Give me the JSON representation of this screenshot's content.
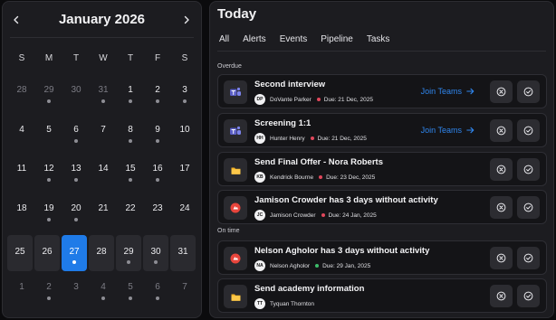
{
  "calendar": {
    "month_title": "January 2026",
    "weekdays": [
      "S",
      "M",
      "T",
      "W",
      "T",
      "F",
      "S"
    ],
    "weeks": [
      [
        {
          "d": "28",
          "m": true,
          "dot": false
        },
        {
          "d": "29",
          "m": true,
          "dot": true
        },
        {
          "d": "30",
          "m": true,
          "dot": false
        },
        {
          "d": "31",
          "m": true,
          "dot": true
        },
        {
          "d": "1",
          "m": false,
          "dot": true
        },
        {
          "d": "2",
          "m": false,
          "dot": true
        },
        {
          "d": "3",
          "m": false,
          "dot": true
        }
      ],
      [
        {
          "d": "4",
          "m": false,
          "dot": false
        },
        {
          "d": "5",
          "m": false,
          "dot": false
        },
        {
          "d": "6",
          "m": false,
          "dot": true
        },
        {
          "d": "7",
          "m": false,
          "dot": false
        },
        {
          "d": "8",
          "m": false,
          "dot": true
        },
        {
          "d": "9",
          "m": false,
          "dot": true
        },
        {
          "d": "10",
          "m": false,
          "dot": false
        }
      ],
      [
        {
          "d": "11",
          "m": false,
          "dot": false
        },
        {
          "d": "12",
          "m": false,
          "dot": true
        },
        {
          "d": "13",
          "m": false,
          "dot": true
        },
        {
          "d": "14",
          "m": false,
          "dot": false
        },
        {
          "d": "15",
          "m": false,
          "dot": true
        },
        {
          "d": "16",
          "m": false,
          "dot": true
        },
        {
          "d": "17",
          "m": false,
          "dot": false
        }
      ],
      [
        {
          "d": "18",
          "m": false,
          "dot": false
        },
        {
          "d": "19",
          "m": false,
          "dot": true
        },
        {
          "d": "20",
          "m": false,
          "dot": true
        },
        {
          "d": "21",
          "m": false,
          "dot": false
        },
        {
          "d": "22",
          "m": false,
          "dot": false
        },
        {
          "d": "23",
          "m": false,
          "dot": false
        },
        {
          "d": "24",
          "m": false,
          "dot": false
        }
      ],
      [
        {
          "d": "25",
          "m": false,
          "dot": false
        },
        {
          "d": "26",
          "m": false,
          "dot": false
        },
        {
          "d": "27",
          "m": false,
          "dot": true,
          "sel": true
        },
        {
          "d": "28",
          "m": false,
          "dot": false
        },
        {
          "d": "29",
          "m": false,
          "dot": true
        },
        {
          "d": "30",
          "m": false,
          "dot": true
        },
        {
          "d": "31",
          "m": false,
          "dot": false
        }
      ],
      [
        {
          "d": "1",
          "m": true,
          "dot": false
        },
        {
          "d": "2",
          "m": true,
          "dot": true
        },
        {
          "d": "3",
          "m": true,
          "dot": false
        },
        {
          "d": "4",
          "m": true,
          "dot": true
        },
        {
          "d": "5",
          "m": true,
          "dot": true
        },
        {
          "d": "6",
          "m": true,
          "dot": true
        },
        {
          "d": "7",
          "m": true,
          "dot": false
        }
      ]
    ],
    "selected_day": "27"
  },
  "today": {
    "title": "Today",
    "tabs": [
      "All",
      "Alerts",
      "Events",
      "Pipeline",
      "Tasks"
    ],
    "active_tab": "All",
    "overdue_label": "Overdue",
    "ontime_label": "On time",
    "items": [
      {
        "title": "Second interview",
        "initials": "DP",
        "person": "DoVante Parker",
        "due": "Due: 21 Dec, 2025",
        "dot_color": "#e0475b",
        "icon": "teams-icon",
        "join": "Join Teams"
      },
      {
        "title": "Screening 1:1",
        "initials": "HH",
        "person": "Hunter Henry",
        "due": "Due: 21 Dec, 2025",
        "dot_color": "#e0475b",
        "icon": "teams-icon",
        "join": "Join Teams"
      },
      {
        "title": "Send Final Offer - Nora Roberts",
        "initials": "KB",
        "person": "Kendrick Bourne",
        "due": "Due: 23 Dec, 2025",
        "dot_color": "#e0475b",
        "icon": "folder-icon"
      },
      {
        "title": "Jamison Crowder has 3 days without activity",
        "initials": "JC",
        "person": "Jamison Crowder",
        "due": "Due: 24 Jan, 2025",
        "dot_color": "#e0475b",
        "icon": "alert-icon"
      },
      {
        "title": "Nelson Agholor has 3 days without activity",
        "initials": "NA",
        "person": "Nelson Agholor",
        "due": "Due: 29 Jan, 2025",
        "dot_color": "#3dbd6a",
        "icon": "alert-icon"
      },
      {
        "title": "Send academy information",
        "initials": "TT",
        "person": "Tyquan Thornton",
        "due": "",
        "dot_color": "",
        "icon": "folder-icon"
      }
    ]
  },
  "colors": {
    "accent": "#1f7be8",
    "overdue": "#e0475b",
    "on_time": "#3dbd6a"
  }
}
